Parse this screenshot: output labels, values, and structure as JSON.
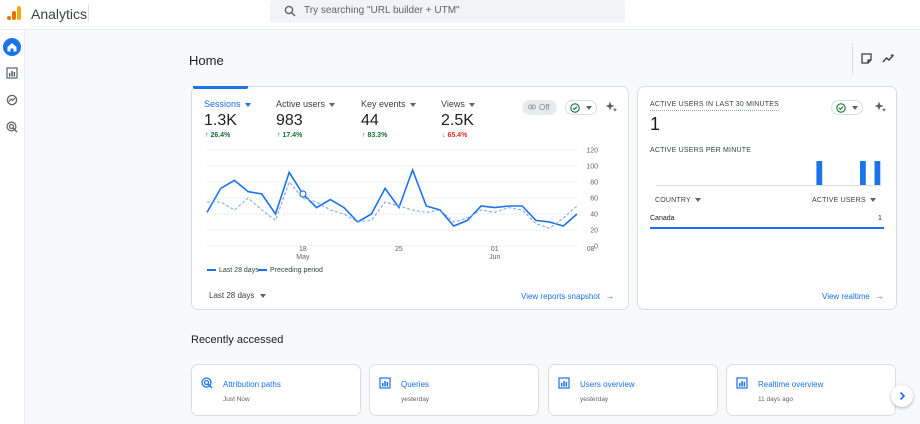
{
  "app": {
    "title": "Analytics"
  },
  "search": {
    "placeholder": "Try searching \"URL builder + UTM\""
  },
  "page": {
    "title": "Home"
  },
  "metrics": [
    {
      "label": "Sessions",
      "value": "1.3K",
      "change": "26.4%",
      "direction": "up"
    },
    {
      "label": "Active users",
      "value": "983",
      "change": "17.4%",
      "direction": "up"
    },
    {
      "label": "Key events",
      "value": "44",
      "change": "83.3%",
      "direction": "up"
    },
    {
      "label": "Views",
      "value": "2.5K",
      "change": "65.4%",
      "direction": "down"
    }
  ],
  "compare_chip": {
    "label": "Off"
  },
  "chart_data": {
    "type": "line",
    "x_tick_labels": [
      "18",
      "May",
      "25",
      "01",
      "Jun",
      "08"
    ],
    "y_ticks": [
      0,
      20,
      40,
      60,
      80,
      100,
      120
    ],
    "ylim": [
      0,
      120
    ],
    "series": [
      {
        "name": "Last 28 days",
        "style": "solid",
        "values": [
          42,
          72,
          82,
          68,
          65,
          40,
          92,
          65,
          48,
          58,
          48,
          30,
          40,
          72,
          48,
          95,
          50,
          45,
          25,
          32,
          50,
          48,
          50,
          50,
          32,
          30,
          25,
          40
        ]
      },
      {
        "name": "Preceding period",
        "style": "dashed",
        "values": [
          55,
          55,
          45,
          60,
          45,
          32,
          80,
          60,
          55,
          45,
          40,
          30,
          32,
          55,
          50,
          45,
          42,
          45,
          30,
          35,
          45,
          42,
          48,
          45,
          28,
          22,
          35,
          50
        ]
      }
    ],
    "grid": true,
    "legend": "bottom-left"
  },
  "legend": {
    "current": "Last 28 days",
    "previous": "Preceding period"
  },
  "date_range": {
    "label": "Last 28 days"
  },
  "links": {
    "reports_snapshot": "View reports snapshot",
    "realtime": "View realtime"
  },
  "realtime": {
    "header": "ACTIVE USERS IN LAST 30 MINUTES",
    "count": "1",
    "per_minute_label": "ACTIVE USERS PER MINUTE",
    "per_minute_values": [
      0,
      0,
      0,
      0,
      0,
      0,
      0,
      0,
      0,
      0,
      0,
      0,
      0,
      0,
      0,
      0,
      0,
      0,
      0,
      0,
      0,
      0,
      1,
      0,
      0,
      0,
      0,
      0,
      1,
      0,
      1
    ],
    "col_country": "COUNTRY",
    "col_users": "ACTIVE USERS",
    "rows": [
      {
        "country": "Canada",
        "users": "1"
      }
    ]
  },
  "recent": {
    "title": "Recently accessed",
    "items": [
      {
        "name": "Attribution paths",
        "time": "Just Now",
        "icon": "attribution-icon"
      },
      {
        "name": "Queries",
        "time": "yesterday",
        "icon": "report-icon"
      },
      {
        "name": "Users overview",
        "time": "yesterday",
        "icon": "report-icon"
      },
      {
        "name": "Realtime overview",
        "time": "11 days ago",
        "icon": "report-icon"
      }
    ]
  },
  "colors": {
    "accent": "#1a73e8",
    "up": "#137333",
    "down": "#d93025"
  }
}
